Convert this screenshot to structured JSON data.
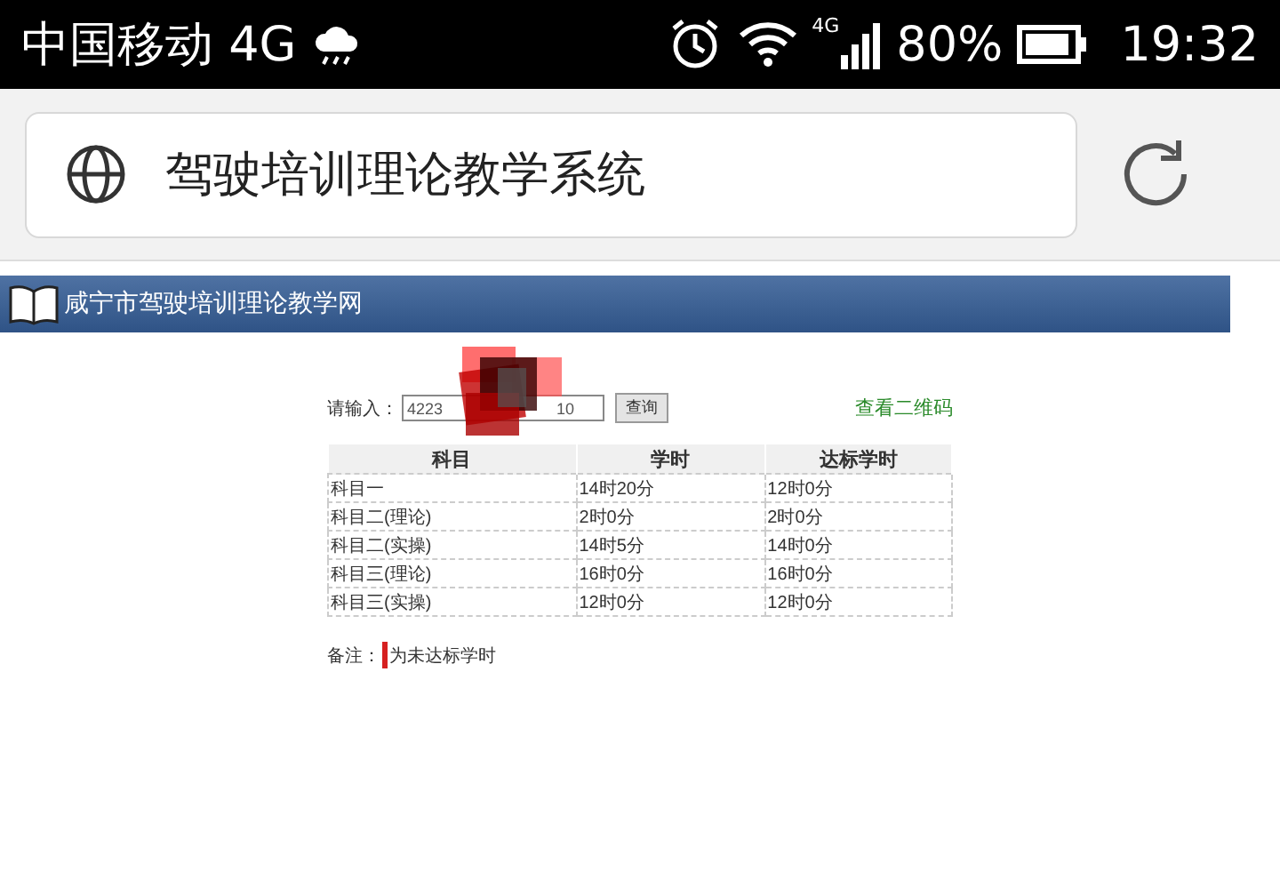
{
  "status_bar": {
    "carrier": "中国移动 4G",
    "network": "4G",
    "battery": "80%",
    "time": "19:32"
  },
  "address_bar": {
    "title": "驾驶培训理论教学系统"
  },
  "site_header": {
    "title": "咸宁市驾驶培训理论教学网"
  },
  "query": {
    "label": "请输入：",
    "value_start": "4223",
    "value_end": "10",
    "button": "查询",
    "qr_link": "查看二维码"
  },
  "table": {
    "columns": [
      "科目",
      "学时",
      "达标学时"
    ],
    "rows": [
      {
        "cells": [
          "科目一",
          "14时20分",
          "12时0分"
        ],
        "below_standard": false
      },
      {
        "cells": [
          "科目二(理论)",
          "2时0分",
          "2时0分"
        ],
        "below_standard": false
      },
      {
        "cells": [
          "科目二(实操)",
          "14时5分",
          "14时0分"
        ],
        "below_standard": false
      },
      {
        "cells": [
          "科目三(理论)",
          "16时0分",
          "16时0分"
        ],
        "below_standard": false
      },
      {
        "cells": [
          "科目三(实操)",
          "12时0分",
          "12时0分"
        ],
        "below_standard": false
      }
    ]
  },
  "note": {
    "label": "备注：",
    "text": "为未达标学时"
  }
}
